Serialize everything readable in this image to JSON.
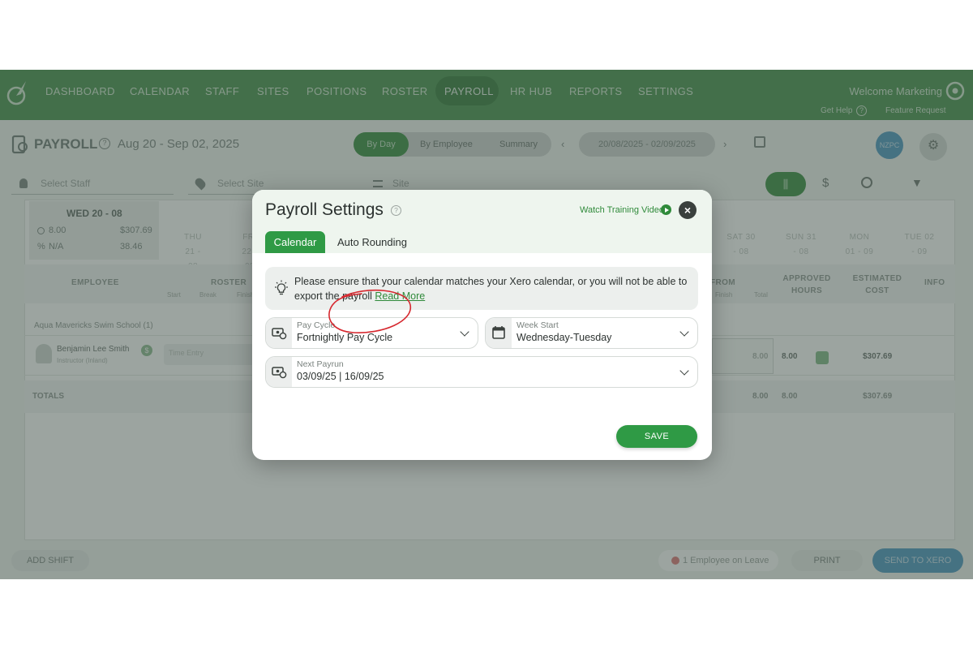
{
  "app": {
    "nav": [
      "DASHBOARD",
      "CALENDAR",
      "STAFF",
      "SITES",
      "POSITIONS",
      "ROSTER",
      "PAYROLL",
      "HR HUB",
      "REPORTS",
      "SETTINGS"
    ],
    "nav_active": "PAYROLL",
    "welcome": "Welcome Marketing",
    "get_help": "Get Help",
    "feature_request": "Feature Request"
  },
  "page": {
    "title": "PAYROLL",
    "date_range_title": "Aug 20 - Sep 02, 2025",
    "view_modes": [
      "By Day",
      "By Employee",
      "Summary"
    ],
    "active_view": "By Day",
    "range": "20/08/2025 - 02/09/2025",
    "avatar_initials": "NZPC"
  },
  "filters": {
    "staff_placeholder": "Select Staff",
    "site_placeholder": "Select Site",
    "sort_value": "Site"
  },
  "daycard": {
    "title": "WED 20 - 08",
    "hours": "8.00",
    "cost": "$307.69",
    "percent": "N/A",
    "chart": "38.46"
  },
  "day_headers": [
    "THU 21 - 08",
    "FRI 22 - 08",
    "SAT 30 - 08",
    "SUN 31 - 08",
    "MON 01 - 09",
    "TUE 02 - 09"
  ],
  "table": {
    "headers": {
      "employee": "EMPLOYEE",
      "roster": "ROSTER",
      "roster_sub": [
        "Start",
        "Break",
        "Finish"
      ],
      "from": "FROM",
      "from_sub": [
        "Finish",
        "Total"
      ],
      "approved_hours": "APPROVED HOURS",
      "estimated_cost": "ESTIMATED COST",
      "info": "INFO"
    },
    "site_group": "Aqua Mavericks Swim School (1)",
    "employee": {
      "name": "Benjamin Lee Smith",
      "sub": "Instructor (Inland)",
      "badge": "$",
      "shift_pill": "Time Entry",
      "total": "8.00",
      "approved": "8.00",
      "cost": "$307.69"
    },
    "totals": {
      "label": "TOTALS",
      "total": "8.00",
      "approved": "8.00",
      "cost": "$307.69"
    }
  },
  "footer": {
    "add_shift": "ADD SHIFT",
    "leave": "1 Employee on Leave",
    "print": "PRINT",
    "send": "SEND TO XERO"
  },
  "modal": {
    "title": "Payroll Settings",
    "help": "?",
    "video_link": "Watch Training Video",
    "close": "×",
    "tabs": [
      "Calendar",
      "Auto Rounding"
    ],
    "active_tab": "Calendar",
    "notice_text": "Please ensure that your calendar matches your Xero calendar, or you will not be able to export the payroll",
    "notice_link": "Read More",
    "pay_cycle": {
      "label": "Pay Cycle",
      "value": "Fortnightly Pay Cycle"
    },
    "week_start": {
      "label": "Week Start",
      "value": "Wednesday-Tuesday"
    },
    "next_payrun": {
      "label": "Next Payrun",
      "value": "03/09/25 | 16/09/25"
    },
    "save": "SAVE",
    "annotation_color": "#d6282f"
  },
  "colors": {
    "brand_green": "#2f9a45",
    "nav_green": "#5c9e61",
    "link_green": "#2f8a3a",
    "accent_blue": "#5fa3c8"
  }
}
